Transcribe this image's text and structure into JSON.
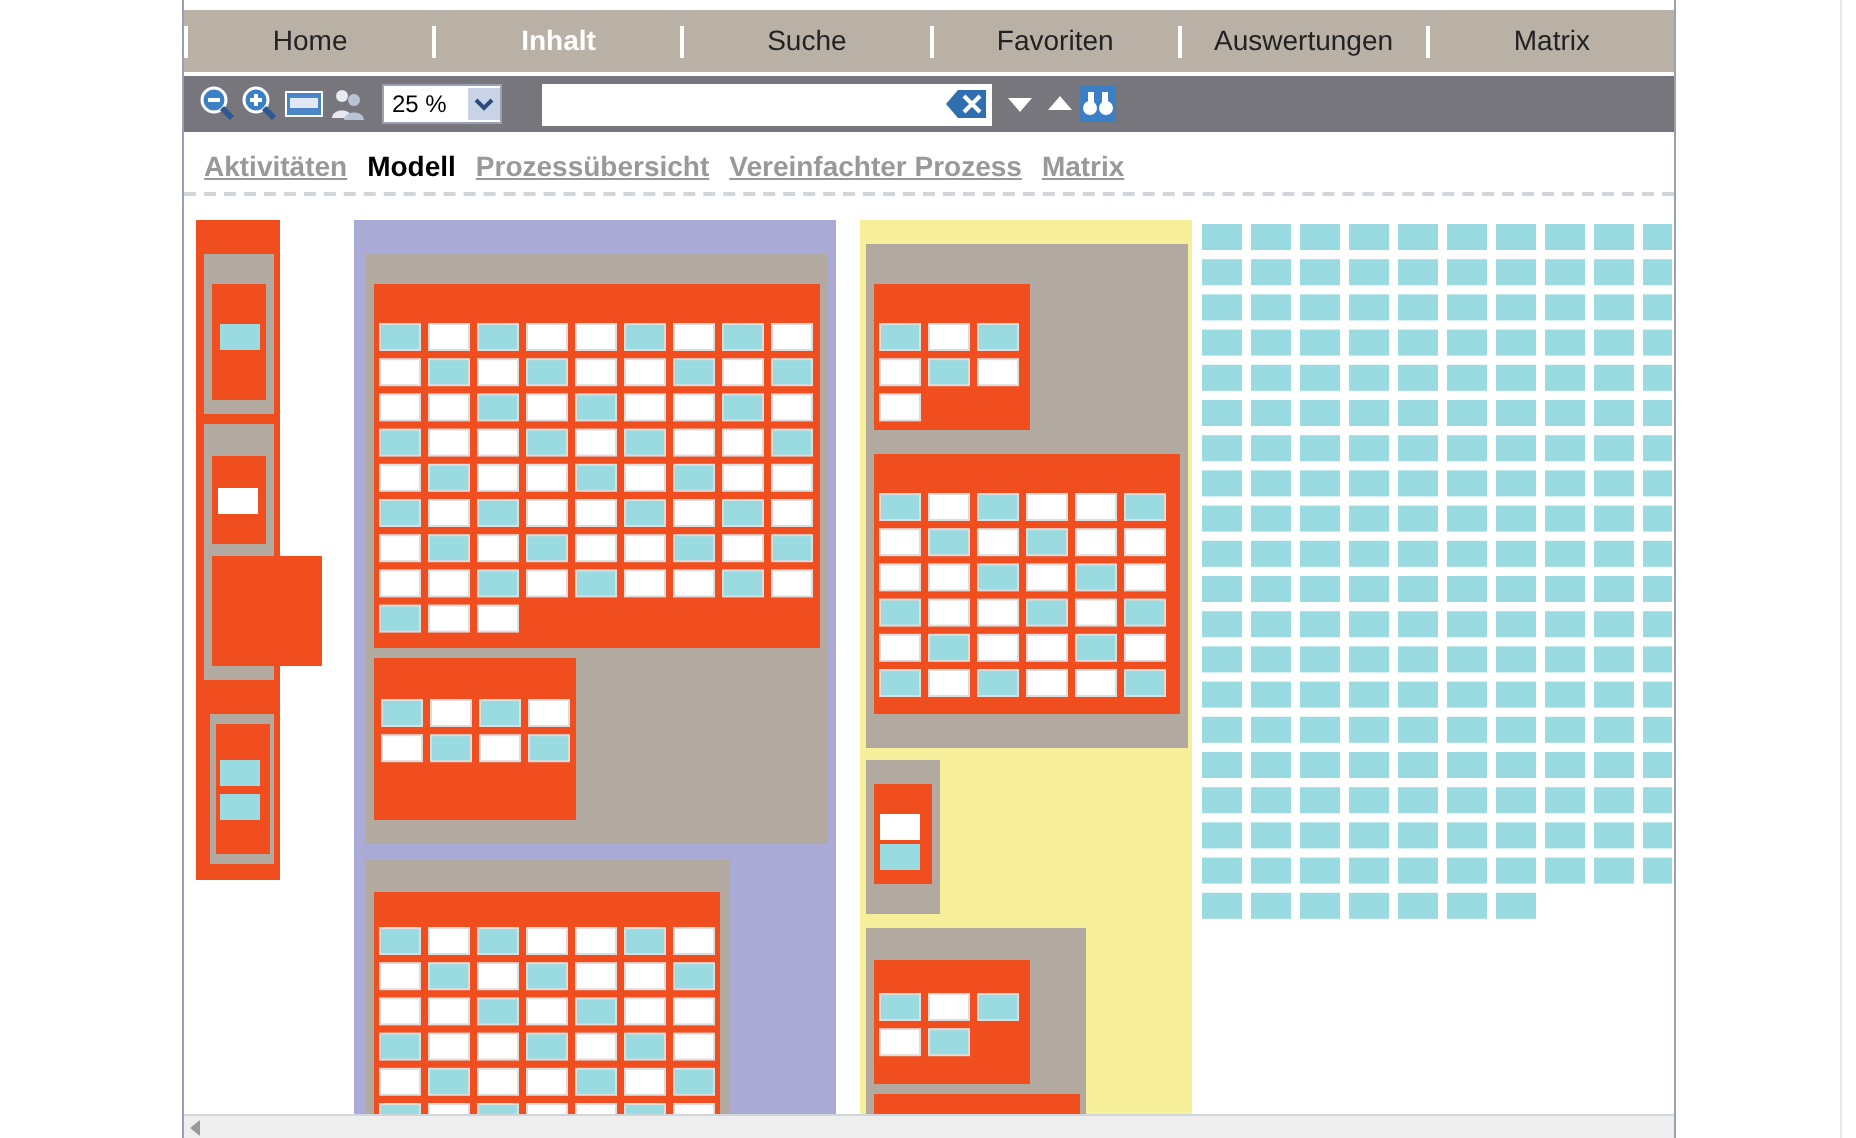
{
  "nav": [
    {
      "label": "Home",
      "selected": false
    },
    {
      "label": "Inhalt",
      "selected": true
    },
    {
      "label": "Suche",
      "selected": false
    },
    {
      "label": "Favoriten",
      "selected": false
    },
    {
      "label": "Auswertungen",
      "selected": false
    },
    {
      "label": "Matrix",
      "selected": false
    }
  ],
  "toolbar": {
    "zoom": "25 %"
  },
  "views": [
    {
      "label": "Aktivitäten",
      "selected": false
    },
    {
      "label": "Modell",
      "selected": true
    },
    {
      "label": "Prozessübersicht",
      "selected": false
    },
    {
      "label": "Vereinfachter Prozess",
      "selected": false
    },
    {
      "label": "Matrix",
      "selected": false
    }
  ]
}
